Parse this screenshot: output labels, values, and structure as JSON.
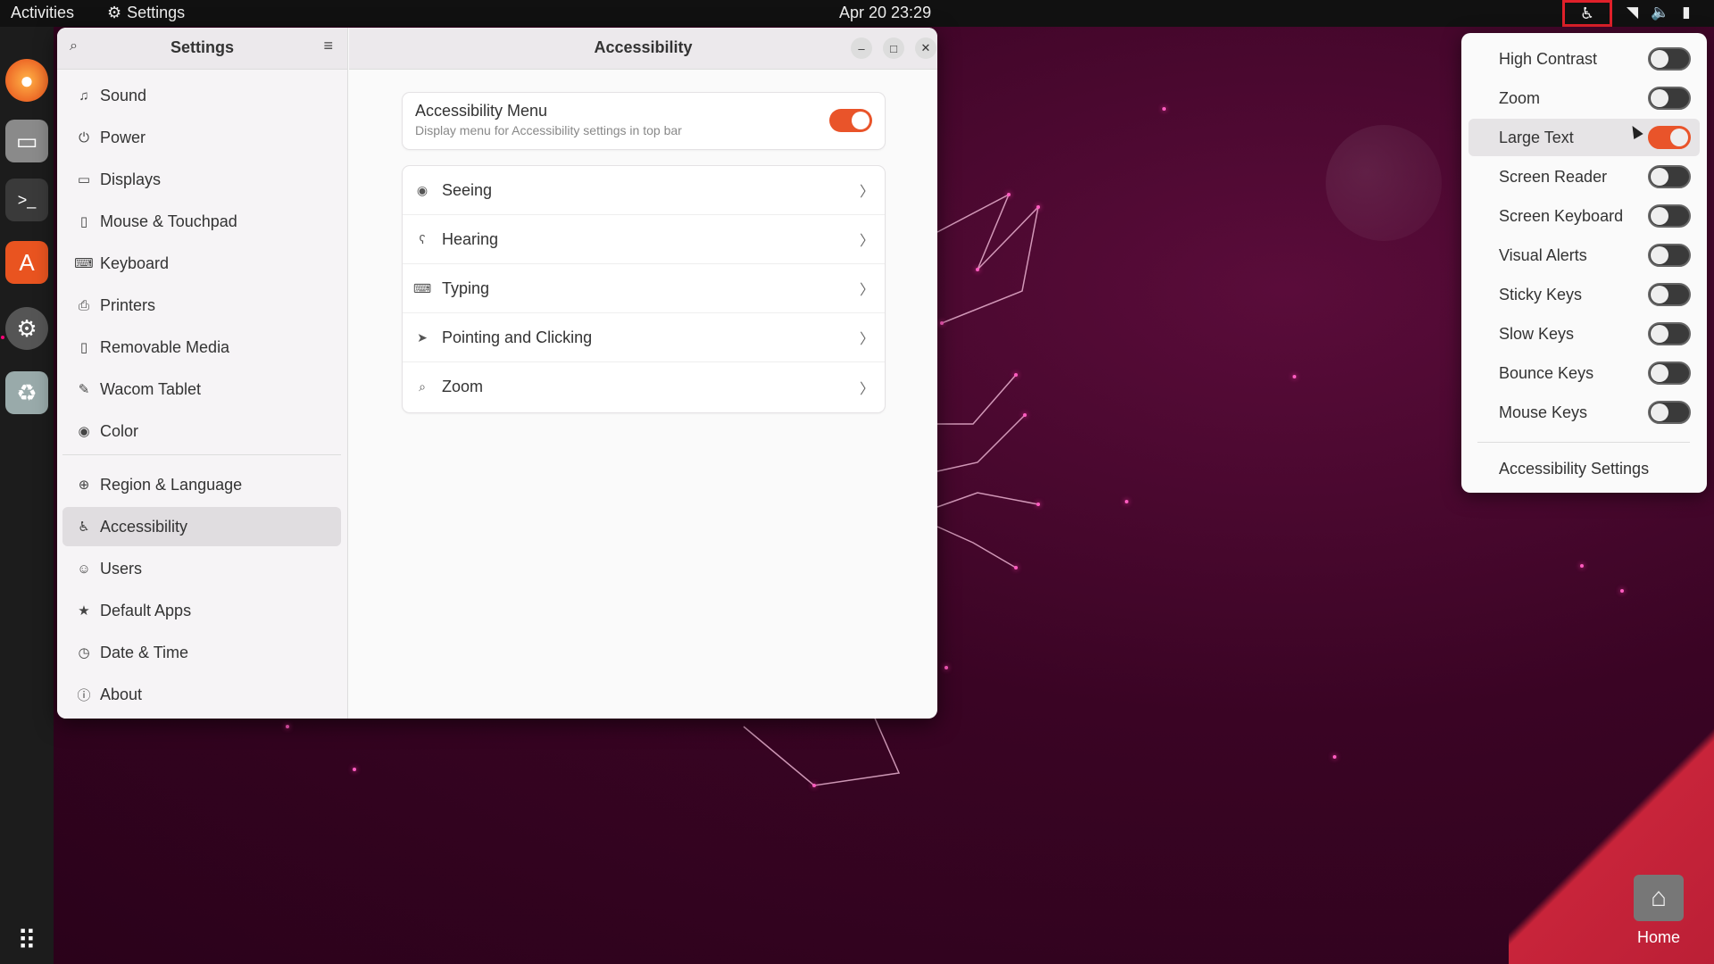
{
  "topbar": {
    "activities": "Activities",
    "app_name": "Settings",
    "clock": "Apr 20  23:29"
  },
  "settings_window": {
    "sidebar_title": "Settings",
    "content_title": "Accessibility",
    "sidebar_items": [
      {
        "label": "Sound",
        "icon": "music-note-icon"
      },
      {
        "label": "Power",
        "icon": "power-icon"
      },
      {
        "label": "Displays",
        "icon": "display-icon"
      },
      {
        "label": "Mouse & Touchpad",
        "icon": "mouse-icon"
      },
      {
        "label": "Keyboard",
        "icon": "keyboard-icon"
      },
      {
        "label": "Printers",
        "icon": "printer-icon"
      },
      {
        "label": "Removable Media",
        "icon": "usb-icon"
      },
      {
        "label": "Wacom Tablet",
        "icon": "tablet-icon"
      },
      {
        "label": "Color",
        "icon": "color-icon"
      },
      {
        "label": "Region & Language",
        "icon": "globe-icon"
      },
      {
        "label": "Accessibility",
        "icon": "accessibility-icon"
      },
      {
        "label": "Users",
        "icon": "users-icon"
      },
      {
        "label": "Default Apps",
        "icon": "star-icon"
      },
      {
        "label": "Date & Time",
        "icon": "clock-icon"
      },
      {
        "label": "About",
        "icon": "info-icon"
      }
    ],
    "accessibility_menu": {
      "label": "Accessibility Menu",
      "description": "Display menu for Accessibility settings in top bar",
      "enabled": true
    },
    "sections": [
      {
        "label": "Seeing",
        "icon": "eye-icon"
      },
      {
        "label": "Hearing",
        "icon": "ear-icon"
      },
      {
        "label": "Typing",
        "icon": "keyboard-icon"
      },
      {
        "label": "Pointing and Clicking",
        "icon": "pointer-icon"
      },
      {
        "label": "Zoom",
        "icon": "magnifier-icon"
      }
    ]
  },
  "a11y_popup": {
    "items": [
      {
        "label": "High Contrast",
        "enabled": false
      },
      {
        "label": "Zoom",
        "enabled": false
      },
      {
        "label": "Large Text",
        "enabled": true
      },
      {
        "label": "Screen Reader",
        "enabled": false
      },
      {
        "label": "Screen Keyboard",
        "enabled": false
      },
      {
        "label": "Visual Alerts",
        "enabled": false
      },
      {
        "label": "Sticky Keys",
        "enabled": false
      },
      {
        "label": "Slow Keys",
        "enabled": false
      },
      {
        "label": "Bounce Keys",
        "enabled": false
      },
      {
        "label": "Mouse Keys",
        "enabled": false
      }
    ],
    "settings_link": "Accessibility Settings"
  },
  "desktop": {
    "home_label": "Home"
  },
  "colors": {
    "accent": "#e9542a",
    "highlight_border": "#e0202a"
  }
}
